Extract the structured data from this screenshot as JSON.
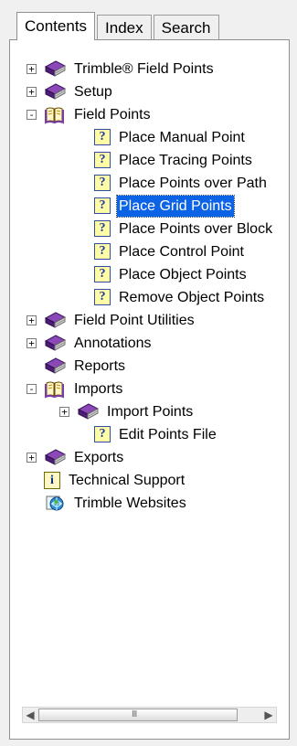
{
  "tabs": {
    "contents": "Contents",
    "index": "Index",
    "search": "Search"
  },
  "tree": {
    "items": [
      {
        "label": "Trimble® Field Points",
        "icon": "closed-book-icon",
        "expander": "+"
      },
      {
        "label": "Setup",
        "icon": "closed-book-icon",
        "expander": "+"
      },
      {
        "label": "Field Points",
        "icon": "open-book-icon",
        "expander": "-"
      },
      {
        "label": "Place Manual Point",
        "icon": "help-page-icon",
        "expander": ""
      },
      {
        "label": "Place Tracing Points",
        "icon": "help-page-icon",
        "expander": ""
      },
      {
        "label": "Place Points over Path",
        "icon": "help-page-icon",
        "expander": ""
      },
      {
        "label": "Place Grid Points",
        "icon": "help-page-icon",
        "expander": "",
        "selected": true
      },
      {
        "label": "Place Points over Block",
        "icon": "help-page-icon",
        "expander": ""
      },
      {
        "label": "Place Control Point",
        "icon": "help-page-icon",
        "expander": ""
      },
      {
        "label": "Place Object Points",
        "icon": "help-page-icon",
        "expander": ""
      },
      {
        "label": "Remove Object Points",
        "icon": "help-page-icon",
        "expander": ""
      },
      {
        "label": "Field Point Utilities",
        "icon": "closed-book-icon",
        "expander": "+"
      },
      {
        "label": "Annotations",
        "icon": "closed-book-icon",
        "expander": "+"
      },
      {
        "label": "Reports",
        "icon": "closed-book-icon",
        "expander": ""
      },
      {
        "label": "Imports",
        "icon": "open-book-icon",
        "expander": "-"
      },
      {
        "label": "Import Points",
        "icon": "closed-book-icon",
        "expander": "+"
      },
      {
        "label": "Edit Points File",
        "icon": "help-page-icon",
        "expander": ""
      },
      {
        "label": "Exports",
        "icon": "closed-book-icon",
        "expander": "+"
      },
      {
        "label": "Technical Support",
        "icon": "info-page-icon",
        "expander": ""
      },
      {
        "label": "Trimble Websites",
        "icon": "web-icon",
        "expander": ""
      }
    ]
  },
  "scrollbar": {
    "left_arrow": "◀",
    "right_arrow": "▶",
    "grip": "III"
  },
  "colors": {
    "selection": "#0d63e6",
    "book": "#5a237d",
    "page_bg": "#ffffff"
  }
}
